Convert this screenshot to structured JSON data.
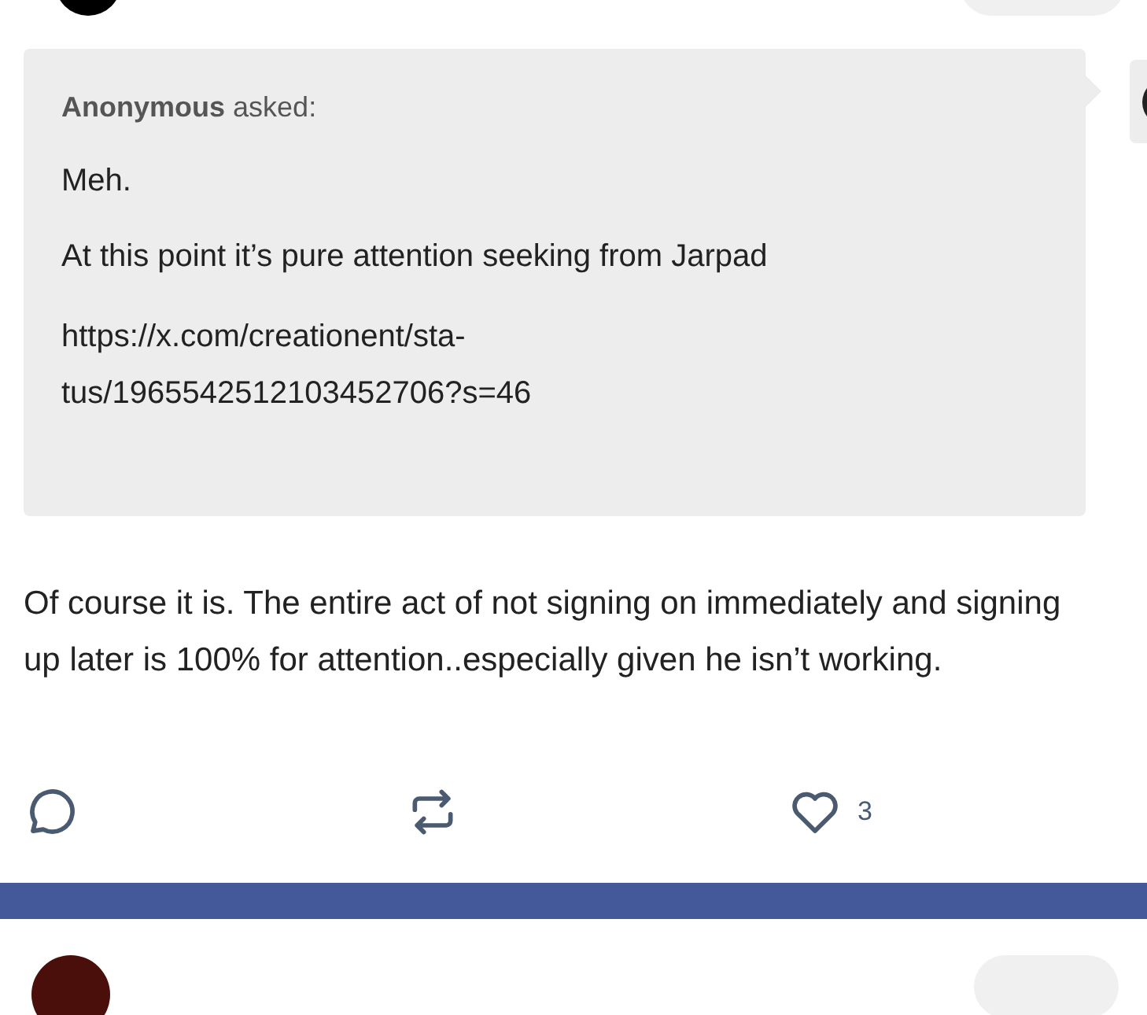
{
  "ask": {
    "asker": "Anonymous",
    "verb": "asked:",
    "paragraphs": [
      "Meh.",
      "At this point it’s pure attention seeking from Jarpad"
    ],
    "link_lines": [
      "https://x.com/creationent/sta-",
      "tus/1965542512103452706?s=46"
    ]
  },
  "answer": "Of course it is. The entire act of not signing on immediately and signing up later is 100% for attention..especially given he isn’t working.",
  "actions": {
    "like_count": "3"
  }
}
